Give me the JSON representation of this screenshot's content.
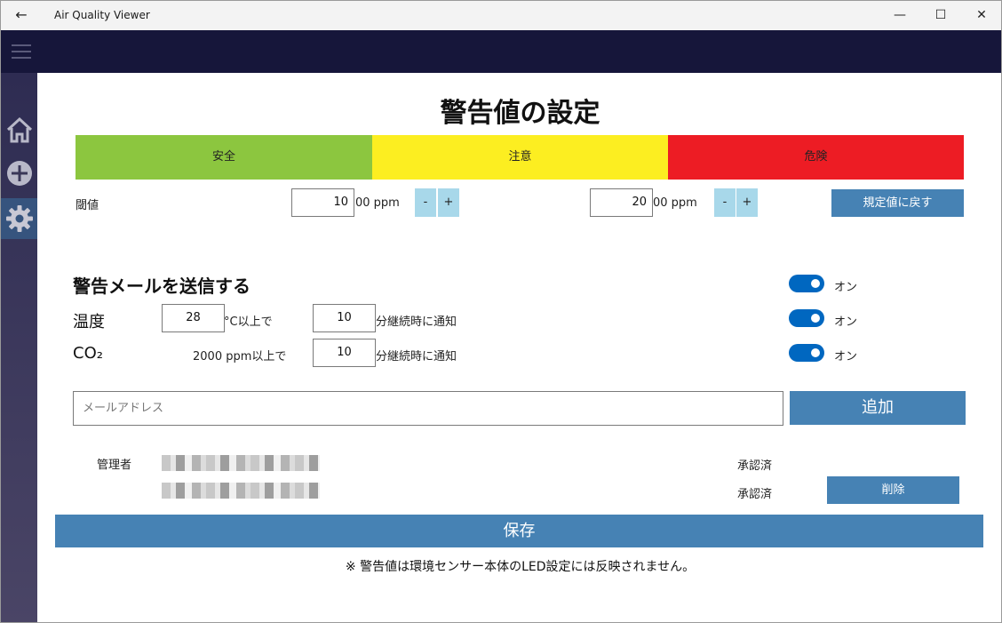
{
  "window": {
    "title": "Air Quality Viewer",
    "back_glyph": "←",
    "minimize_glyph": "—",
    "maximize_glyph": "☐",
    "close_glyph": "✕"
  },
  "sidebar": {
    "items": [
      {
        "name": "home",
        "icon": "home-icon"
      },
      {
        "name": "add",
        "icon": "plus-circle-icon"
      },
      {
        "name": "settings",
        "icon": "gear-icon",
        "selected": true
      }
    ]
  },
  "page": {
    "title": "警告値の設定"
  },
  "bands": [
    {
      "label": "安全",
      "color": "#8cc63f"
    },
    {
      "label": "注意",
      "color": "#fcee21"
    },
    {
      "label": "危険",
      "color": "#ed1c24"
    }
  ],
  "threshold": {
    "label": "閾値",
    "caution": {
      "value": "10",
      "unit": "00 ppm"
    },
    "danger": {
      "value": "20",
      "unit": "00 ppm"
    },
    "minus_label": "-",
    "plus_label": "+",
    "reset_label": "規定値に戻す"
  },
  "email_alert": {
    "heading": "警告メールを送信する",
    "heading_toggle": "オン",
    "temperature": {
      "label": "温度",
      "value": "28",
      "suffix": "°C以上で",
      "duration": "10",
      "duration_suffix": "分継続時に通知",
      "toggle": "オン"
    },
    "co2": {
      "label": "CO₂",
      "threshold_text": "2000 ppm以上で",
      "duration": "10",
      "duration_suffix": "分継続時に通知",
      "toggle": "オン"
    }
  },
  "email_input": {
    "placeholder": "メールアドレス",
    "add_label": "追加"
  },
  "recipients": {
    "admin_label": "管理者",
    "rows": [
      {
        "status": "承認済"
      },
      {
        "status": "承認済",
        "action": "削除"
      }
    ]
  },
  "footer": {
    "save_label": "保存",
    "note": "※ 警告値は環境センサー本体のLED設定には反映されません。"
  },
  "colors": {
    "accent": "#4682b4",
    "toggle_on": "#0067c0",
    "stepper": "#a8d8ea",
    "header_band": "#16163a"
  }
}
